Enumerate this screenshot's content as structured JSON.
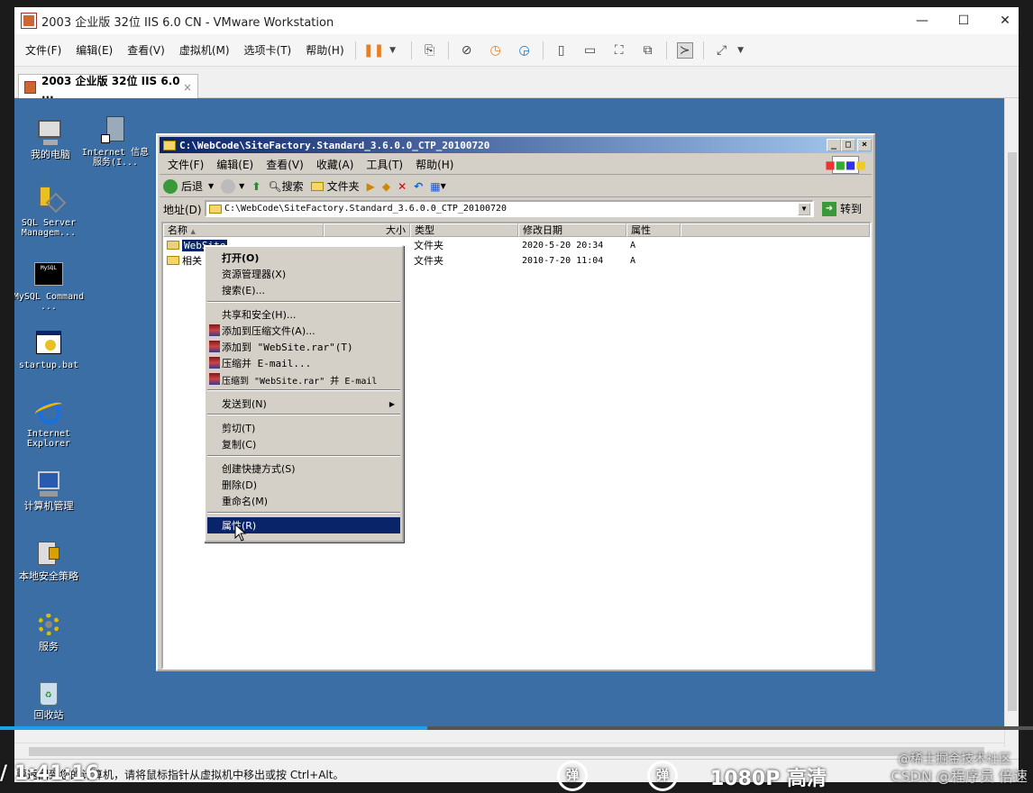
{
  "vmware": {
    "title": "2003 企业版 32位 IIS 6.0 CN - VMware Workstation",
    "window_controls": {
      "minimize": "—",
      "maximize": "☐",
      "close": "✕"
    },
    "menu": [
      "文件(F)",
      "编辑(E)",
      "查看(V)",
      "虚拟机(M)",
      "选项卡(T)",
      "帮助(H)"
    ],
    "tab": {
      "label": "2003 企业版 32位 IIS 6.0 ...",
      "close": "×"
    },
    "status_text": "要返回到您的计算机，请将鼠标指针从虚拟机中移出或按 Ctrl+Alt。"
  },
  "desktop": {
    "icons": [
      {
        "label": "我的电脑",
        "icon": "computer-icon"
      },
      {
        "label": "Internet 信息服务(I...",
        "icon": "iis-icon"
      },
      {
        "label": "SQL Server Managem...",
        "icon": "sql-server-icon"
      },
      {
        "label": "MySQL Command ...",
        "icon": "mysql-icon"
      },
      {
        "label": "startup.bat",
        "icon": "batch-file-icon"
      },
      {
        "label": "Internet Explorer",
        "icon": "ie-icon"
      },
      {
        "label": "计算机管理",
        "icon": "computer-management-icon"
      },
      {
        "label": "本地安全策略",
        "icon": "security-policy-icon"
      },
      {
        "label": "服务",
        "icon": "services-icon"
      },
      {
        "label": "回收站",
        "icon": "recycle-bin-icon"
      }
    ]
  },
  "explorer": {
    "title": "C:\\WebCode\\SiteFactory.Standard_3.6.0.0_CTP_20100720",
    "menu": [
      "文件(F)",
      "编辑(E)",
      "查看(V)",
      "收藏(A)",
      "工具(T)",
      "帮助(H)"
    ],
    "toolbar": {
      "back": "后退",
      "search": "搜索",
      "folders": "文件夹"
    },
    "address_label": "地址(D)",
    "address_value": "C:\\WebCode\\SiteFactory.Standard_3.6.0.0_CTP_20100720",
    "go_label": "转到",
    "columns": [
      "名称",
      "大小",
      "类型",
      "修改日期",
      "属性"
    ],
    "rows": [
      {
        "name": "WebSite",
        "size": "",
        "type": "文件夹",
        "modified": "2020-5-20 20:34",
        "attr": "A"
      },
      {
        "name": "相关",
        "size": "",
        "type": "文件夹",
        "modified": "2010-7-20 11:04",
        "attr": "A"
      }
    ]
  },
  "context_menu": {
    "items": [
      "打开(O)",
      "资源管理器(X)",
      "搜索(E)...",
      "共享和安全(H)...",
      "添加到压缩文件(A)...",
      "添加到 \"WebSite.rar\"(T)",
      "压缩并 E-mail...",
      "压缩到 \"WebSite.rar\" 并 E-mail",
      "发送到(N)",
      "剪切(T)",
      "复制(C)",
      "创建快捷方式(S)",
      "删除(D)",
      "重命名(M)",
      "属性(R)"
    ]
  },
  "video_overlay": {
    "timecode": "/ 1:41:16",
    "danmu1": "弹",
    "danmu2": "弹",
    "quality": "1080P 高清",
    "watermark1": "@稀土掘金技术社区",
    "watermark2": "CSDN @程序员 倍速"
  },
  "video_progress": 0.414
}
